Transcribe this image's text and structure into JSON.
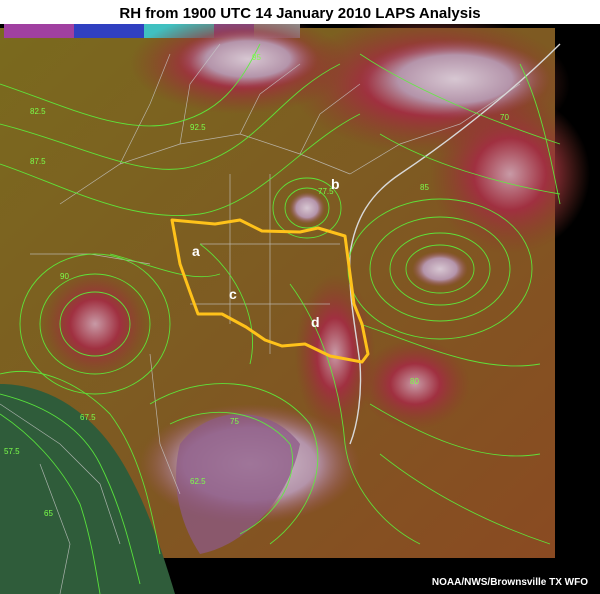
{
  "title": "RH from 1900 UTC 14 January 2010 LAPS Analysis",
  "credit": "NOAA/NWS/Brownsville TX WFO",
  "region_labels": [
    "a",
    "b",
    "c",
    "d"
  ],
  "contour_values": [
    "82.5",
    "95",
    "87.5",
    "92.5",
    "77.5",
    "90",
    "85",
    "75",
    "67.5",
    "57.5",
    "65",
    "62.5",
    "70",
    "80"
  ],
  "colors": {
    "contour": "#5cf03c",
    "outline": "#ffc21a",
    "high_rh": "#8a1f2a",
    "mid_rh": "#8b5a1c",
    "low_rh": "#4f7a2a",
    "saturated": "#b9a0b2",
    "dry": "#2d5e3a",
    "boundaries": "#c8c8c8"
  },
  "legend_bar": [
    "magenta",
    "blue",
    "cyan",
    "purple",
    "gray"
  ]
}
